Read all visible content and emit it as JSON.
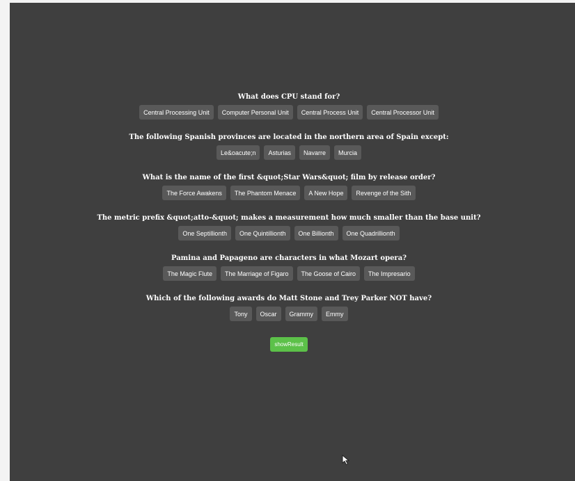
{
  "questions": [
    {
      "text": "What does CPU stand for?",
      "answers": [
        "Central Processing Unit",
        "Computer Personal Unit",
        "Central Process Unit",
        "Central Processor Unit"
      ]
    },
    {
      "text": "The following Spanish provinces are located in the northern area of Spain except:",
      "answers": [
        "Le&oacute;n",
        "Asturias",
        "Navarre",
        "Murcia"
      ]
    },
    {
      "text": "What is the name of the first &quot;Star Wars&quot; film by release order?",
      "answers": [
        "The Force Awakens",
        "The Phantom Menace",
        "A New Hope",
        "Revenge of the Sith"
      ]
    },
    {
      "text": "The metric prefix &quot;atto-&quot; makes a measurement how much smaller than the base unit?",
      "answers": [
        "One Septillionth",
        "One Quintillionth",
        "One Billionth",
        "One Quadrillionth"
      ]
    },
    {
      "text": "Pamina and Papageno are characters in what Mozart opera?",
      "answers": [
        "The Magic Flute",
        "The Marriage of Figaro",
        "The Goose of Cairo",
        "The Impresario"
      ]
    },
    {
      "text": "Which of the following awards do Matt Stone and Trey Parker NOT have?",
      "answers": [
        "Tony",
        "Oscar",
        "Grammy",
        "Emmy"
      ]
    }
  ],
  "result_button_label": "showResult",
  "cursor_icon": "mouse-pointer-icon",
  "colors": {
    "background": "#3f3f3f",
    "button": "#595959",
    "result_button": "#5cc149"
  }
}
